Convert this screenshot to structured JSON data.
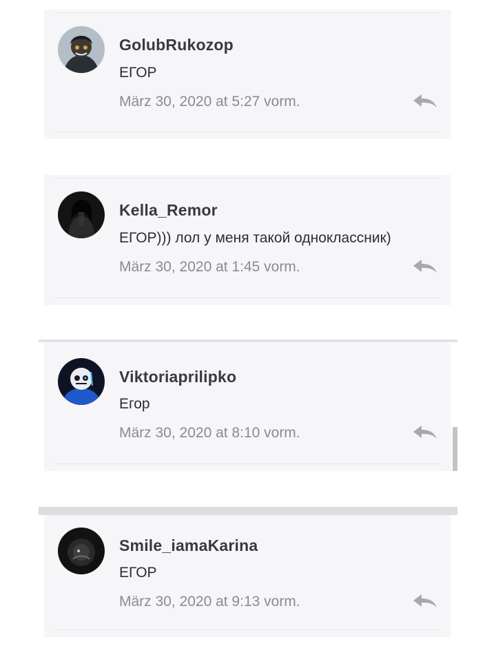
{
  "comments": [
    {
      "author": "GolubRukozop",
      "text": "ЕГОР",
      "date": "März 30, 2020 at 5:27 vorm.",
      "avatar_icon": "avatar-golubrukozop"
    },
    {
      "author": "Kella_Remor",
      "text": "ЕГОР))) лол у меня такой одноклассник)",
      "date": "März 30, 2020 at 1:45 vorm.",
      "avatar_icon": "avatar-kella-remor"
    },
    {
      "author": "Viktoriaprilipko",
      "text": "Егор",
      "date": "März 30, 2020 at 8:10 vorm.",
      "avatar_icon": "avatar-viktoriaprilipko"
    },
    {
      "author": "Smile_iamaKarina",
      "text": "ЕГОР",
      "date": "März 30, 2020 at 9:13 vorm.",
      "avatar_icon": "avatar-smile-iamakarina"
    }
  ],
  "icons": {
    "reply": "reply-arrow-icon"
  },
  "colors": {
    "card_background": "#f6f5f8",
    "author_text": "#3a3a3e",
    "date_text": "#8b8a90",
    "reply_icon": "#a9a8ad"
  }
}
